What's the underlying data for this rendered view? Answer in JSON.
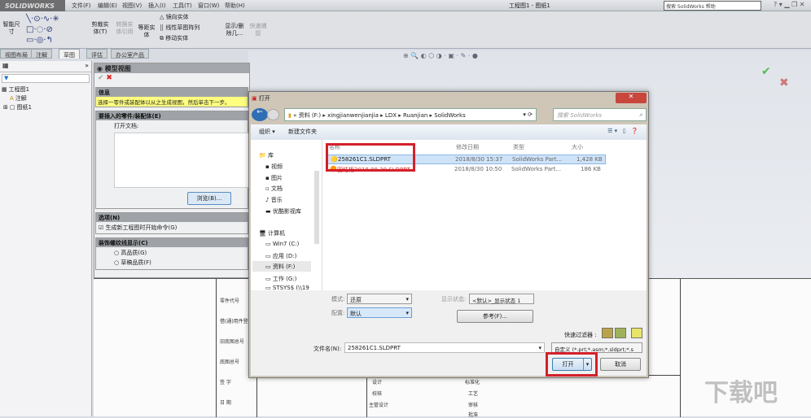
{
  "app": {
    "logo": "SOLIDWORKS",
    "title": "工程图1 - 图纸1",
    "help_search_placeholder": "搜索 SolidWorks 帮助",
    "menu": [
      "文件(F)",
      "编辑(E)",
      "视图(V)",
      "插入(I)",
      "工具(T)",
      "窗口(W)",
      "帮助(H)"
    ]
  },
  "ribbon": {
    "smart_dim": "智能尺寸",
    "trim": "剪裁实体(T)",
    "convert": "转换实体引用",
    "offset": "等距实体",
    "mirror": "镜向实体",
    "linear_pattern": "线性草图阵列",
    "move": "移动实体",
    "show_delete": "显示/删除几...",
    "quick_snap": "快速捕捉"
  },
  "tabs": [
    "视图布局",
    "注解",
    "草图",
    "评估",
    "办公室产品"
  ],
  "active_tab": "草图",
  "tree": {
    "items": [
      "工程图1",
      "注解",
      "图纸1"
    ]
  },
  "property_manager": {
    "title": "模型视图",
    "info_header": "信息",
    "info_text": "选择一零件或装配体以从之生成视图，然后单击下一步。",
    "part_header": "要插入的零件/装配体(E)",
    "open_docs_label": "打开文档:",
    "browse_button": "浏览(B)...",
    "options_header": "选项(N)",
    "options_checkbox": "生成新工程图时开始命令(G)",
    "options_checked": true,
    "thread_header": "装饰螺纹线显示(C)",
    "radio_high": "高品质(G)",
    "radio_draft": "草稿品质(F)"
  },
  "dialog": {
    "title": "打开",
    "breadcrumb": [
      "资料 (F:)",
      "xingjianwenjianjia",
      "LDX",
      "Ruanjian",
      "SolidWorks"
    ],
    "search_placeholder": "搜索 SolidWorks",
    "organize": "组织 ▾",
    "new_folder": "新建文件夹",
    "nav": {
      "libraries": "库",
      "items": [
        "视频",
        "图片",
        "文档",
        "音乐",
        "优酷影视库"
      ],
      "computer": "计算机",
      "drives": [
        "Win7 (C:)",
        "应用 (D:)",
        "资料 (F:)",
        "工作 (G:)",
        "STSYS$ (\\\\19"
      ]
    },
    "columns": [
      "名称",
      "修改日期",
      "类型",
      "大小"
    ],
    "files": [
      {
        "name": "258261C1.SLDPRT",
        "date": "2018/8/30 15:37",
        "type": "SolidWorks Part...",
        "size": "1,428 KB"
      },
      {
        "name": "固结柜2018.08.30.SLDPRT",
        "date": "2018/8/30 10:50",
        "type": "SolidWorks Part...",
        "size": "186 KB"
      }
    ],
    "mode_label": "模式:",
    "mode_value": "还原",
    "config_label": "配置:",
    "config_value": "默认",
    "display_state_label": "显示状态:",
    "display_state_value": "<默认>_显示状态 1",
    "reference_button": "参考(F)...",
    "quick_filter_label": "快速过滤器 :",
    "filename_label": "文件名(N):",
    "filename_value": "258261C1.SLDPRT",
    "filetype_value": "自定义 (*.prt;*.asm;*.sldprt;*.s",
    "open_button": "打开",
    "cancel_button": "取消"
  },
  "title_block": {
    "left": [
      "零件代号",
      "借(通)用件登记",
      "旧底图总号",
      "底图总号",
      "签 字",
      "日 期"
    ],
    "mid1": [
      "设计",
      "校核",
      "主管设计"
    ],
    "mid2": [
      "标准化",
      "工艺",
      "审核",
      "批准"
    ]
  },
  "watermark": "下载吧",
  "colors": {
    "highlight_red": "#d4202a",
    "info_yellow": "#ffff80",
    "selection_blue": "#cfe3f8"
  }
}
